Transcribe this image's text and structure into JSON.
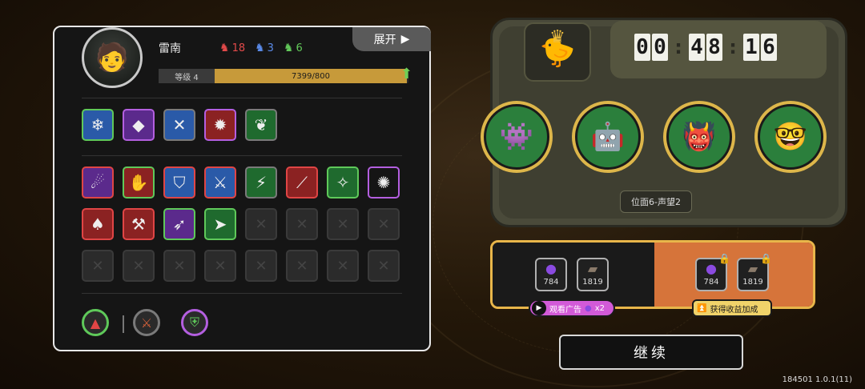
{
  "hero": {
    "name": "雷南",
    "stats": [
      {
        "icon": "red-demon-icon",
        "value": "18",
        "color": "#e24a4a"
      },
      {
        "icon": "blue-demon-icon",
        "value": "3",
        "color": "#5a8ae8"
      },
      {
        "icon": "green-demon-icon",
        "value": "6",
        "color": "#62c95a"
      }
    ],
    "level_label": "等级 4",
    "exp_text": "7399/800",
    "exp_progress": 1.0
  },
  "expand_label": "展开",
  "equipment_row": [
    {
      "icon": "ice-spire-icon",
      "border": "green",
      "bg": "blue",
      "glyph": "❄"
    },
    {
      "icon": "violet-gem-icon",
      "border": "purple",
      "bg": "purple",
      "glyph": "◆"
    },
    {
      "icon": "crossed-blades-icon",
      "border": "gray",
      "bg": "blue",
      "glyph": "✕"
    },
    {
      "icon": "mech-crab-icon",
      "border": "purple",
      "bg": "red",
      "glyph": "✹"
    },
    {
      "icon": "green-leaf-icon",
      "border": "gray",
      "bg": "green",
      "glyph": "❦"
    }
  ],
  "skill_rows": [
    [
      {
        "icon": "purple-beast-skill-icon",
        "border": "red",
        "bg": "purple",
        "glyph": "☄"
      },
      {
        "icon": "red-claw-skill-icon",
        "border": "green",
        "bg": "red",
        "glyph": "✋"
      },
      {
        "icon": "blue-shield-skill-icon",
        "border": "red",
        "bg": "blue",
        "glyph": "⛉"
      },
      {
        "icon": "blue-strike-skill-icon",
        "border": "red",
        "bg": "blue",
        "glyph": "⚔"
      },
      {
        "icon": "green-spikes-skill-icon",
        "border": "gray",
        "bg": "green",
        "glyph": "⚡"
      },
      {
        "icon": "red-slash-skill-icon",
        "border": "red",
        "bg": "red",
        "glyph": "⟋"
      },
      {
        "icon": "green-crystal-skill-icon",
        "border": "green",
        "bg": "green",
        "glyph": "✧"
      },
      {
        "icon": "bomb-skill-icon",
        "border": "purple",
        "bg": "gray",
        "glyph": "✺"
      }
    ],
    [
      {
        "icon": "red-fang-skill-icon",
        "border": "red",
        "bg": "red",
        "glyph": "♠"
      },
      {
        "icon": "red-axe-skill-icon",
        "border": "red",
        "bg": "red",
        "glyph": "⚒"
      },
      {
        "icon": "purple-arrow-skill-icon",
        "border": "green",
        "bg": "purple",
        "glyph": "➶"
      },
      {
        "icon": "red-arrow-skill-icon",
        "border": "green",
        "bg": "green",
        "glyph": "➤"
      }
    ]
  ],
  "empty_slot_glyph": "✕",
  "bottom_icons": [
    {
      "icon": "red-triangle-icon",
      "glyph": "▲",
      "color": "#e04545",
      "ring": "#5fc95a"
    },
    {
      "icon": "red-sword-icon",
      "glyph": "⚔",
      "color": "#d0603a",
      "ring": "#7a7a7a"
    },
    {
      "icon": "green-shield-icon",
      "glyph": "⛨",
      "color": "#5fc95a",
      "ring": "#b45fe0"
    }
  ],
  "console": {
    "crown_icon": "crown-icon",
    "timer": [
      "00",
      "48",
      "16"
    ],
    "portraits": [
      {
        "icon": "red-eyed-insect-portrait",
        "glyph": "👾"
      },
      {
        "icon": "robot-helmet-portrait",
        "glyph": "🤖"
      },
      {
        "icon": "hooded-red-creature-portrait",
        "glyph": "👹"
      },
      {
        "icon": "glasses-kid-portrait",
        "glyph": "🤓"
      }
    ],
    "rank_label": "位面6-声望2"
  },
  "rewards": {
    "base": [
      {
        "icon": "purple-orb-icon",
        "glyph": "●",
        "color": "#8a4ae0",
        "value": "784"
      },
      {
        "icon": "book-icon",
        "glyph": "▰",
        "color": "#8a7a6a",
        "value": "1819"
      }
    ],
    "bonus": [
      {
        "icon": "purple-orb-icon",
        "glyph": "●",
        "color": "#8a4ae0",
        "value": "784"
      },
      {
        "icon": "book-icon",
        "glyph": "▰",
        "color": "#8a7a6a",
        "value": "1819"
      }
    ],
    "ad_label": "观看广告",
    "ad_multiplier": "x2",
    "bonus_label": "获得收益加成"
  },
  "continue_label": "继续",
  "version": "184501 1.0.1(11)"
}
